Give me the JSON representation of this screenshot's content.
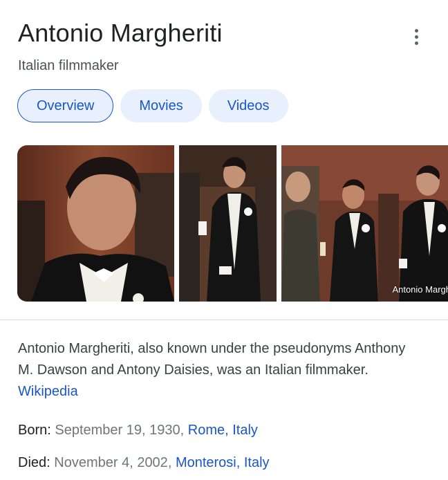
{
  "header": {
    "title": "Antonio Margheriti",
    "subtitle": "Italian filmmaker"
  },
  "tabs": [
    {
      "label": "Overview",
      "active": true
    },
    {
      "label": "Movies",
      "active": false
    },
    {
      "label": "Videos",
      "active": false
    }
  ],
  "images": {
    "caption": "Antonio Margh"
  },
  "description": {
    "text": "Antonio Margheriti, also known under the pseudonyms Anthony M. Dawson and Antony Daisies, was an Italian filmmaker.",
    "source_link": "Wikipedia"
  },
  "facts": {
    "born": {
      "label": "Born",
      "date": "September 19, 1930",
      "place": "Rome, Italy"
    },
    "died": {
      "label": "Died",
      "date": "November 4, 2002",
      "place": "Monterosi, Italy"
    }
  },
  "colors": {
    "link": "#1a56c8",
    "tab_bg": "#e8f0fe"
  },
  "icons": {
    "more": "more-vert-icon"
  }
}
